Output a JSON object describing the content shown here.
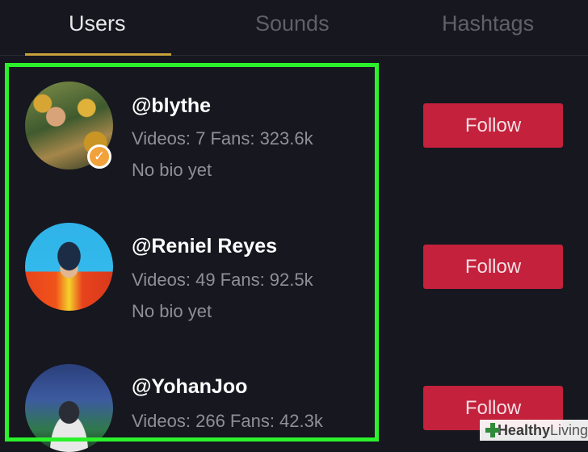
{
  "tabs": [
    {
      "label": "Users",
      "active": true
    },
    {
      "label": "Sounds",
      "active": false
    },
    {
      "label": "Hashtags",
      "active": false
    }
  ],
  "users": [
    {
      "handle": "@blythe",
      "stats": "Videos: 7 Fans: 323.6k",
      "bio": "No bio yet",
      "verified": true,
      "follow_label": "Follow"
    },
    {
      "handle": "@Reniel Reyes",
      "stats": "Videos: 49 Fans: 92.5k",
      "bio": "No bio yet",
      "verified": false,
      "follow_label": "Follow"
    },
    {
      "handle": "@YohanJoo",
      "stats": "Videos: 266 Fans: 42.3k",
      "bio": "",
      "verified": false,
      "follow_label": "Follow"
    }
  ],
  "watermark": {
    "bold": "Healthy",
    "regular": "Living"
  },
  "colors": {
    "follow_button": "#c3213c",
    "highlight": "#2bf12b",
    "tab_underline": "#c8a23a",
    "verified_badge": "#f2a13b",
    "background": "#16171f"
  }
}
